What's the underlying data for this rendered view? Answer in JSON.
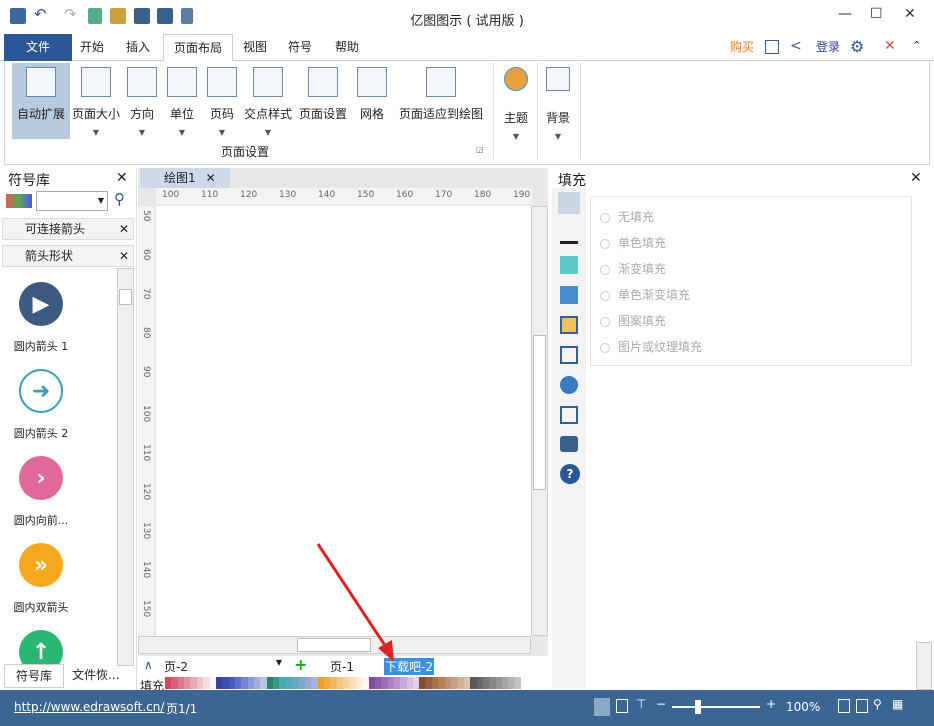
{
  "app": {
    "title": "亿图图示 ( 试用版 )"
  },
  "menu": {
    "file": "文件",
    "tabs": [
      "开始",
      "插入",
      "页面布局",
      "视图",
      "符号",
      "帮助"
    ],
    "active": "页面布局",
    "buy": "购买",
    "login": "登录"
  },
  "ribbon": {
    "buttons": [
      {
        "label": "自动扩展",
        "dropdown": false
      },
      {
        "label": "页面大小",
        "dropdown": true
      },
      {
        "label": "方向",
        "dropdown": true
      },
      {
        "label": "单位",
        "dropdown": true
      },
      {
        "label": "页码",
        "dropdown": true
      },
      {
        "label": "交点样式",
        "dropdown": true
      },
      {
        "label": "页面设置",
        "dropdown": false
      },
      {
        "label": "网格",
        "dropdown": false
      },
      {
        "label": "页面适应到绘图",
        "dropdown": false
      }
    ],
    "group_label": "页面设置",
    "theme": "主题",
    "background": "背景"
  },
  "left": {
    "title": "符号库",
    "libraries": [
      "可连接箭头",
      "箭头形状"
    ],
    "symbols": [
      {
        "label": "圆内箭头 1",
        "color": "#3d5a80",
        "glyph": "▶"
      },
      {
        "label": "圆内箭头 2",
        "color": "#ffffff",
        "glyph": "➜"
      },
      {
        "label": "圆内向前...",
        "color": "#e0699a",
        "glyph": "›"
      },
      {
        "label": "圆内双箭头",
        "color": "#f5a81c",
        "glyph": "»"
      },
      {
        "label": "",
        "color": "#2bb673",
        "glyph": "↑"
      }
    ],
    "tabs": [
      "符号库",
      "文件恢..."
    ]
  },
  "doc": {
    "tab": "绘图1",
    "ruler_h": [
      "100",
      "110",
      "120",
      "130",
      "140",
      "150",
      "160",
      "170",
      "180",
      "190"
    ],
    "ruler_v": [
      "50",
      "60",
      "70",
      "80",
      "90",
      "100",
      "110",
      "120",
      "130",
      "140",
      "150"
    ]
  },
  "pages": {
    "current": "页-2",
    "tabs": [
      "页-1",
      "下载吧-2"
    ]
  },
  "fill_bar_label": "填充",
  "right": {
    "title": "填充",
    "options": [
      "无填充",
      "单色填充",
      "渐变填充",
      "单色渐变填充",
      "图案填充",
      "图片或纹理填充"
    ]
  },
  "status": {
    "url": "http://www.edrawsoft.cn/",
    "page": "页1/1",
    "zoom": "100%",
    "zoom_fraction": 0.3
  }
}
